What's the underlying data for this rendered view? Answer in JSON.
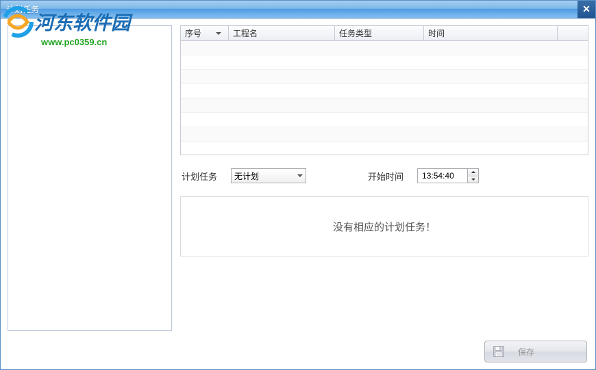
{
  "window": {
    "title": "计划任务"
  },
  "watermark": {
    "text": "河东软件园",
    "url": "www.pc0359.cn"
  },
  "table": {
    "columns": [
      "序号",
      "工程名",
      "任务类型",
      "时间"
    ],
    "widths": [
      70,
      155,
      130,
      195
    ],
    "rows": []
  },
  "controls": {
    "plan_task_label": "计划任务",
    "plan_task_value": "无计划",
    "start_time_label": "开始时间",
    "start_time_value": "13:54:40"
  },
  "message": "没有相应的计划任务！",
  "footer": {
    "save_label": "保存"
  },
  "colors": {
    "title_gradient_top": "#a5cef0",
    "title_gradient_bottom": "#4d9be3",
    "border": "#bcc6da"
  }
}
